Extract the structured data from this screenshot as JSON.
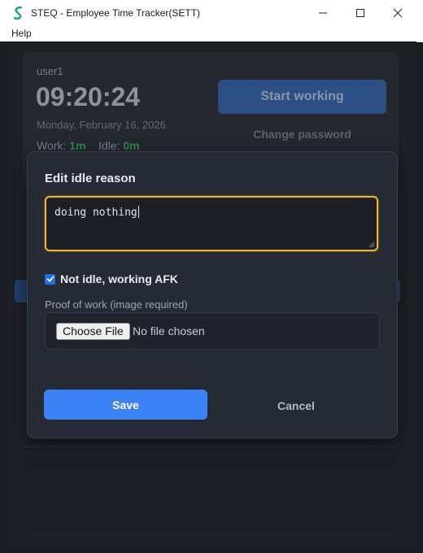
{
  "window": {
    "title": "STEQ - Employee Time Tracker(SETT)",
    "menu": [
      "Help"
    ]
  },
  "background": {
    "user": "user1",
    "clock": "09:20:24",
    "date": "Monday, February 16, 2026",
    "work_label": "Work:",
    "work_value": "1m",
    "idle_label": "Idle:",
    "idle_value": "0m",
    "start_button": "Start working",
    "change_password": "Change password"
  },
  "modal": {
    "title": "Edit idle reason",
    "reason_value": "doing nothing",
    "afk_checked": true,
    "afk_label": "Not idle, working AFK",
    "proof_label": "Proof of work (image required)",
    "choose_file": "Choose File",
    "file_status": "No file chosen",
    "save": "Save",
    "cancel": "Cancel"
  },
  "colors": {
    "accent": "#3b82f6",
    "focus_border": "#f0b429",
    "green": "#2a8a52"
  }
}
